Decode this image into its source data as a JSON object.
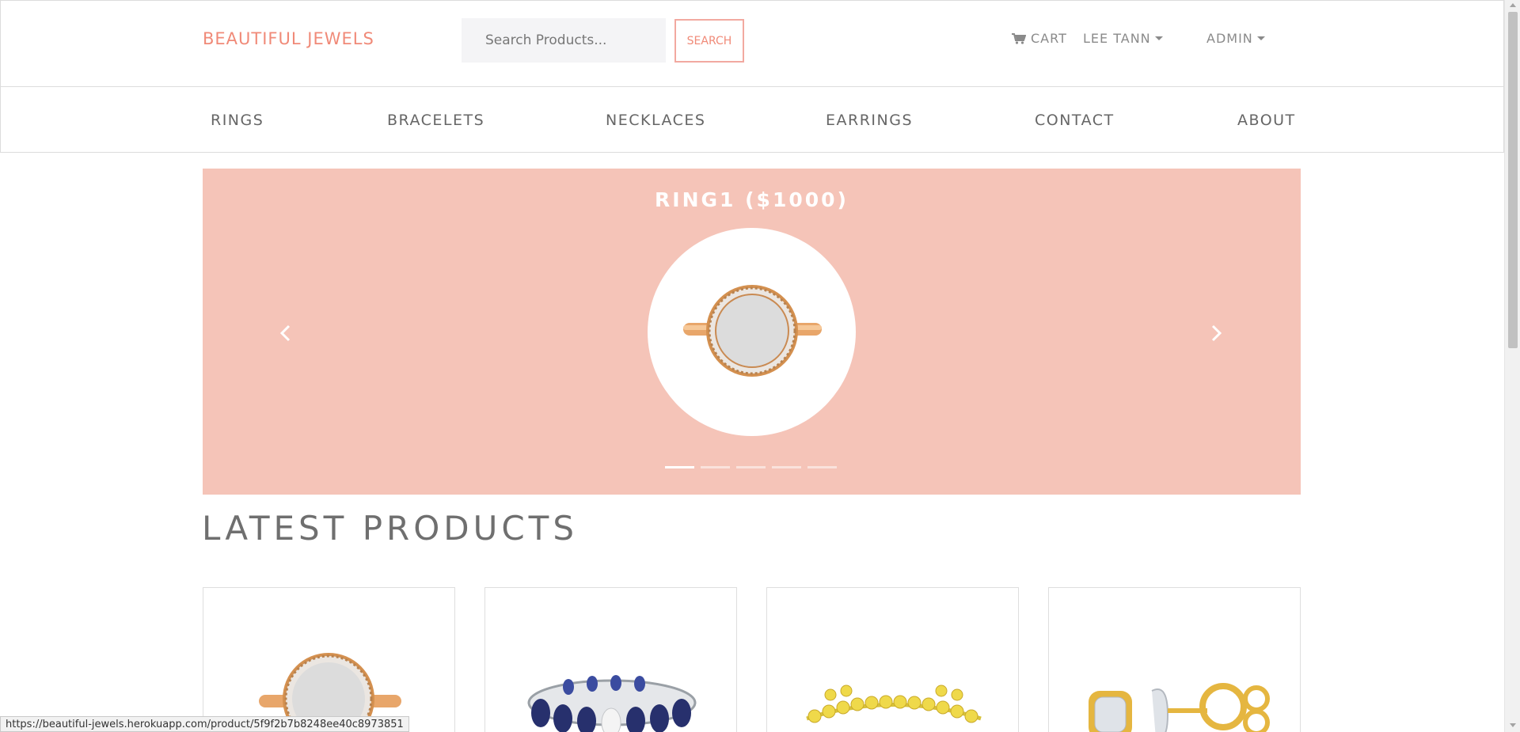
{
  "header": {
    "brand": "BEAUTIFUL JEWELS",
    "search": {
      "placeholder": "Search Products...",
      "value": "",
      "button_label": "SEARCH"
    },
    "cart_label": "CART",
    "user_label": "LEE TANN",
    "admin_label": "ADMIN"
  },
  "categories": [
    "RINGS",
    "BRACELETS",
    "NECKLACES",
    "EARRINGS",
    "CONTACT",
    "ABOUT"
  ],
  "carousel": {
    "slide_title": "RING1 ($1000)",
    "slide_count": 5,
    "active_index": 0
  },
  "latest": {
    "title": "LATEST PRODUCTS",
    "products": [
      {
        "image": "rose-gold-halo-ring"
      },
      {
        "image": "sapphire-eternity-band"
      },
      {
        "image": "gold-bead-bracelet"
      },
      {
        "image": "diamond-stud-earrings"
      }
    ]
  },
  "status_url": "https://beautiful-jewels.herokuapp.com/product/5f9f2b7b8248ee40c8973851",
  "colors": {
    "accent": "#f08a78",
    "carousel_bg": "#f5c4b8",
    "text": "#6b6b6b"
  }
}
